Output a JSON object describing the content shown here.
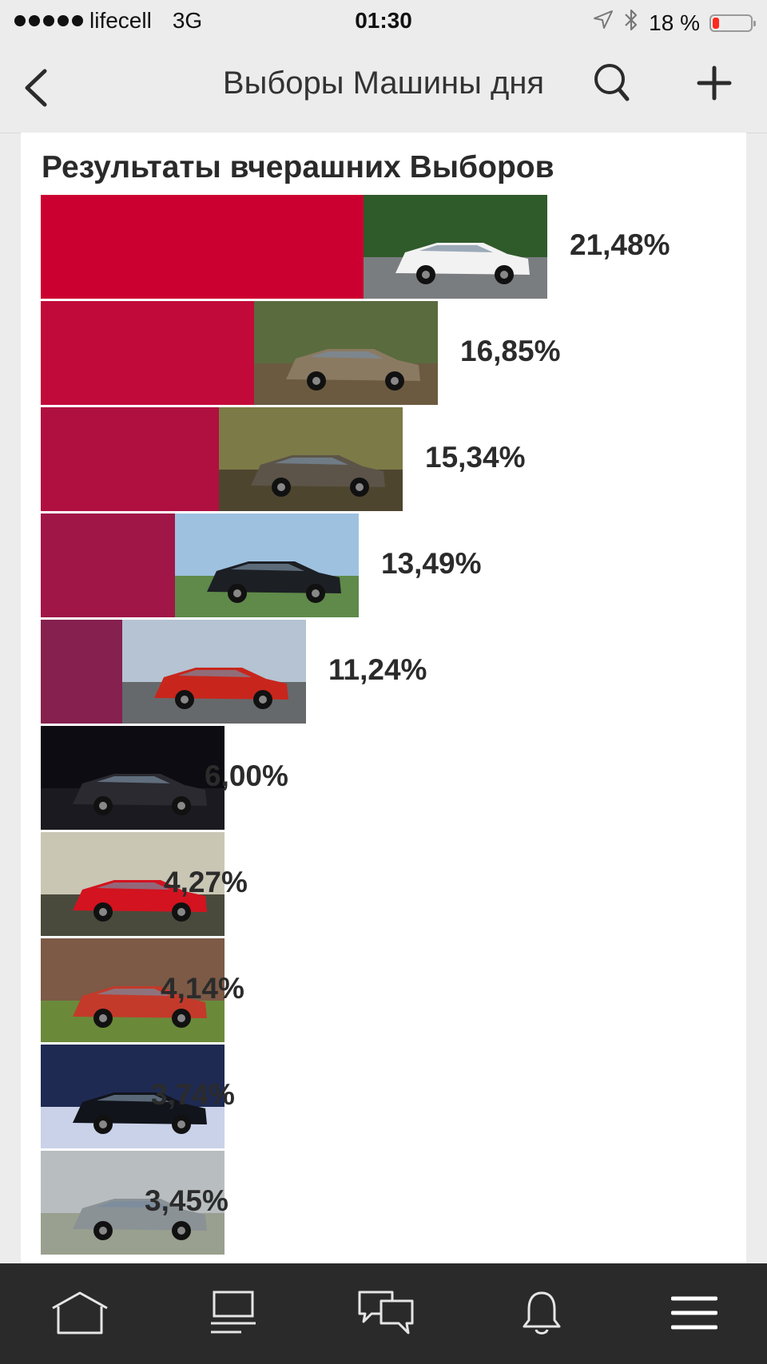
{
  "status_bar": {
    "carrier": "lifecell",
    "network": "3G",
    "time": "01:30",
    "battery": "18 %",
    "battery_level": 0.18,
    "battery_color": "#ff2a1f"
  },
  "nav": {
    "title": "Выборы Машины дня",
    "back_icon": "chevron-left-icon",
    "search_icon": "search-icon",
    "add_icon": "plus-icon"
  },
  "card": {
    "title": "Результаты вчерашних Выборов"
  },
  "chart_data": {
    "type": "bar",
    "orientation": "horizontal",
    "title": "Результаты вчерашних Выборов",
    "values": [
      21.48,
      16.85,
      15.34,
      13.49,
      11.24,
      6.0,
      4.27,
      4.14,
      3.74,
      3.45
    ],
    "labels": [
      "21,48%",
      "16,85%",
      "15,34%",
      "13,49%",
      "11,24%",
      "6,00%",
      "4,27%",
      "4,14%",
      "3,74%",
      "3,45%"
    ],
    "colors": [
      "#cc0030",
      "#c20a3a",
      "#b0103f",
      "#a01747",
      "#86204f",
      "#6a2460",
      "#5a2a70",
      "#443478",
      "#2f4080",
      "#204c90"
    ],
    "photos": [
      "white-sedan-photo",
      "muddy-pickup-photo",
      "muddy-suv-photo",
      "black-sedan-girl-photo",
      "red-coupe-girl-photo",
      "night-car-photo",
      "red-wagon-photo",
      "red-hatchback-photo",
      "dark-sedan-snow-photo",
      "grey-sedan-photo"
    ]
  },
  "tab_bar": {
    "items": [
      {
        "name": "home-icon"
      },
      {
        "name": "feed-icon"
      },
      {
        "name": "messages-icon"
      },
      {
        "name": "notifications-bell-icon"
      },
      {
        "name": "menu-icon"
      }
    ]
  }
}
